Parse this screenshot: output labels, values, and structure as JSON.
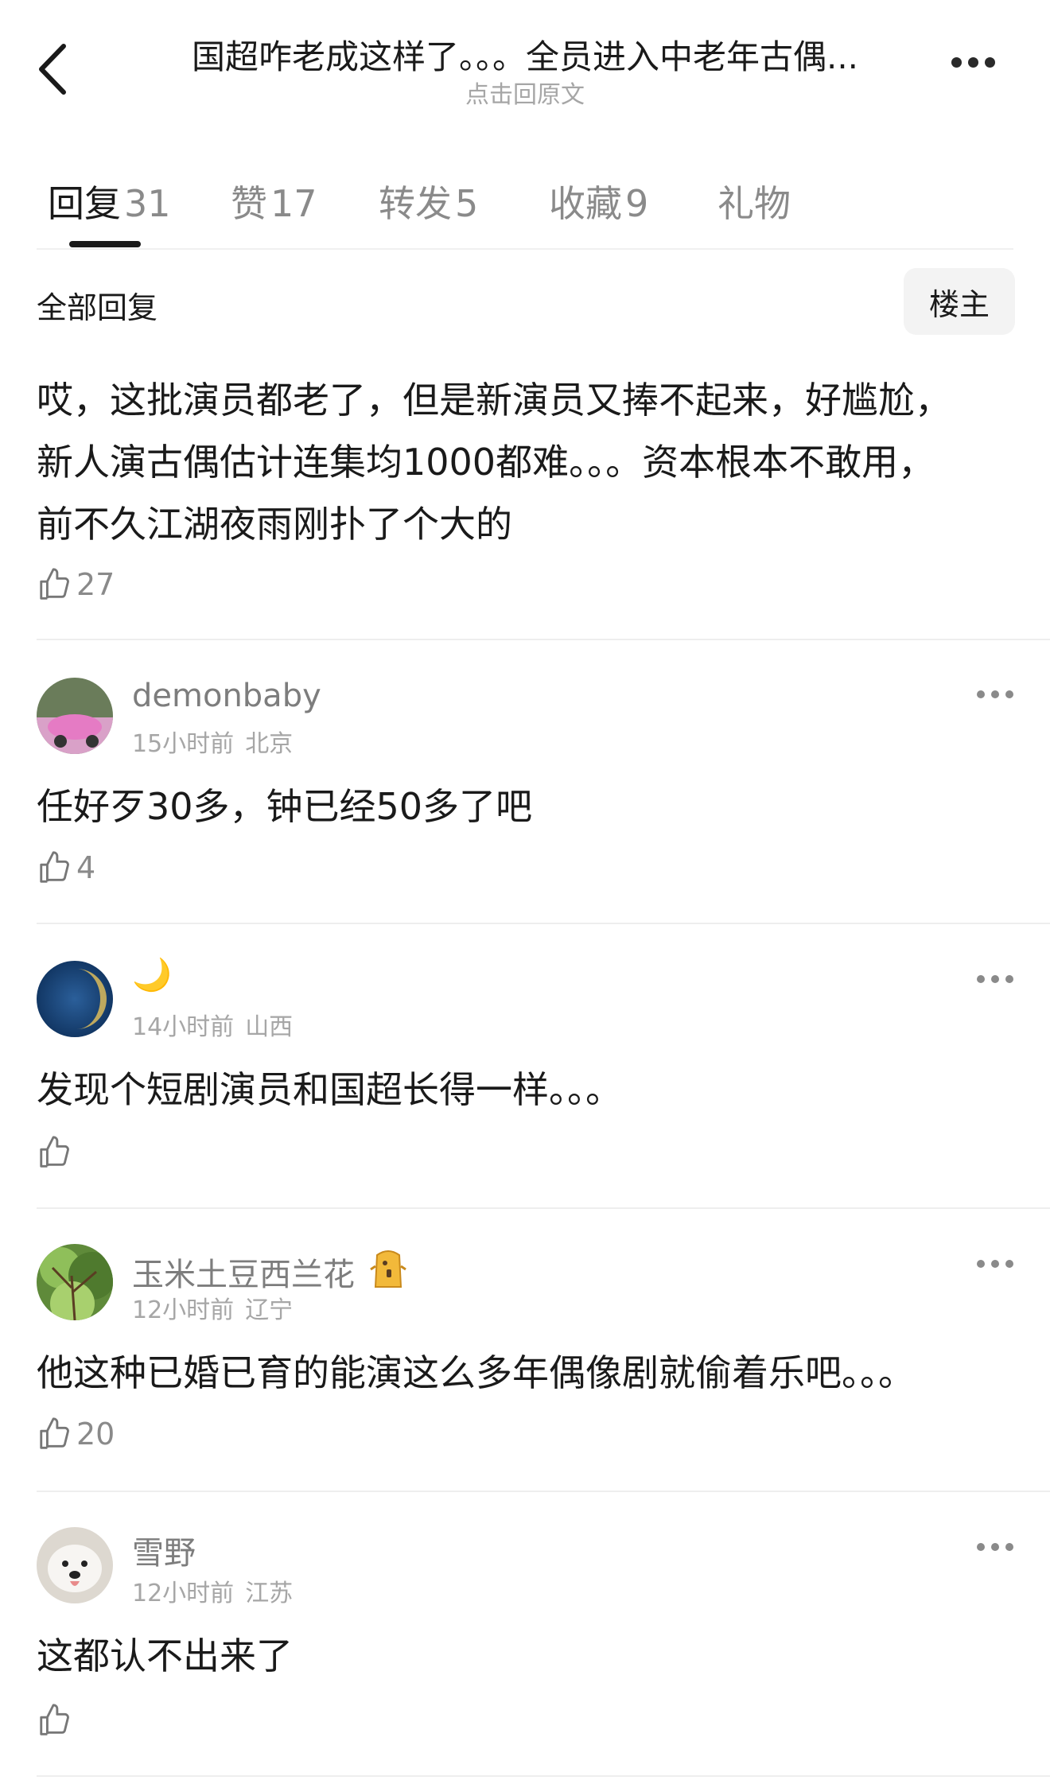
{
  "header": {
    "title": "国超咋老成这样了。。。全员进入中老年古偶...",
    "subtitle": "点击回原文"
  },
  "tabs": [
    {
      "label": "回复",
      "count": "31"
    },
    {
      "label": "赞",
      "count": "17"
    },
    {
      "label": "转发",
      "count": "5"
    },
    {
      "label": "收藏",
      "count": "9"
    },
    {
      "label": "礼物",
      "count": ""
    }
  ],
  "filter": {
    "all_label": "全部回复",
    "owner_label": "楼主"
  },
  "top_reply": {
    "lines": [
      "哎，这批演员都老了，但是新演员又捧不起来，好尴尬，",
      "新人演古偶估计连集均1000都难。。。资本根本不敢用，",
      "前不久江湖夜雨刚扑了个大的"
    ],
    "likes": "27"
  },
  "comments": [
    {
      "username": "demonbaby",
      "time": "15小时前",
      "location": "北京",
      "text": "任好歹30多，钟已经50多了吧",
      "likes": "4"
    },
    {
      "username": "🌙",
      "time": "14小时前",
      "location": "山西",
      "text": "发现个短剧演员和国超长得一样。。。",
      "likes": ""
    },
    {
      "username": "玉米土豆西兰花",
      "time": "12小时前",
      "location": "辽宁",
      "text": "他这种已婚已育的能演这么多年偶像剧就偷着乐吧。。。",
      "likes": "20"
    },
    {
      "username": "雪野",
      "time": "12小时前",
      "location": "江苏",
      "text": "这都认不出来了",
      "likes": ""
    }
  ],
  "colors": {
    "text_primary": "#1a1a1a",
    "text_secondary": "#8a8a8a",
    "text_tertiary": "#a6a6a6",
    "divider": "#eeeeee"
  }
}
